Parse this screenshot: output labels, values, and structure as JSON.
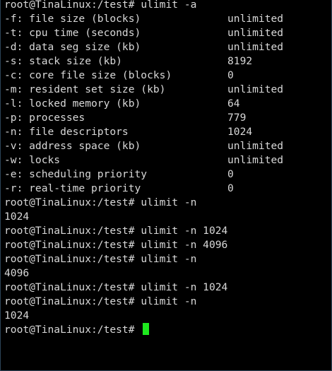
{
  "prompt": "root@TinaLinux:/test#",
  "colors": {
    "background": "#000000",
    "text": "#d8d8d8",
    "cursor": "#1ee81e",
    "border": "#2d4459"
  },
  "session": {
    "first_command": "ulimit -a",
    "limits": [
      {
        "name": "-f: file size (blocks)",
        "value": "unlimited"
      },
      {
        "name": "-t: cpu time (seconds)",
        "value": "unlimited"
      },
      {
        "name": "-d: data seg size (kb)",
        "value": "unlimited"
      },
      {
        "name": "-s: stack size (kb)",
        "value": "8192"
      },
      {
        "name": "-c: core file size (blocks)",
        "value": "0"
      },
      {
        "name": "-m: resident set size (kb)",
        "value": "unlimited"
      },
      {
        "name": "-l: locked memory (kb)",
        "value": "64"
      },
      {
        "name": "-p: processes",
        "value": "779"
      },
      {
        "name": "-n: file descriptors",
        "value": "1024"
      },
      {
        "name": "-v: address space (kb)",
        "value": "unlimited"
      },
      {
        "name": "-w: locks",
        "value": "unlimited"
      },
      {
        "name": "-e: scheduling priority",
        "value": "0"
      },
      {
        "name": "-r: real-time priority",
        "value": "0"
      }
    ],
    "history": [
      {
        "command": "ulimit -n",
        "output": "1024"
      },
      {
        "command": "ulimit -n 1024",
        "output": null
      },
      {
        "command": "ulimit -n 4096",
        "output": null
      },
      {
        "command": "ulimit -n",
        "output": "4096"
      },
      {
        "command": "ulimit -n 1024",
        "output": null
      },
      {
        "command": "ulimit -n",
        "output": "1024"
      }
    ]
  }
}
